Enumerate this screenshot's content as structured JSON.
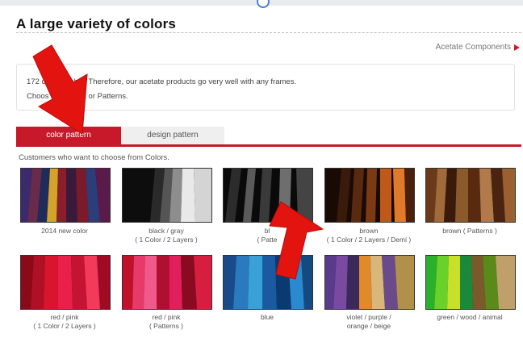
{
  "page": {
    "title": "A large variety of colors",
    "acetate_link": "Acetate Components",
    "info_line1": "172 c          e available. Therefore, our acetate products go very well with any frames.",
    "info_line2": "Choos            her Colors or Patterns.",
    "subtitle": "Customers who want to choose from Colors."
  },
  "tabs": [
    {
      "label": "color pattern",
      "active": true
    },
    {
      "label": "design pattern",
      "active": false
    }
  ],
  "swatches": [
    {
      "cap1": "2014 new color",
      "cap2": ""
    },
    {
      "cap1": "black / gray",
      "cap2": "( 1 Color / 2 Layers )"
    },
    {
      "cap1": "bl",
      "cap2": "( Patte"
    },
    {
      "cap1": "brown",
      "cap2": "( 1 Color / 2 Layers / Demi )"
    },
    {
      "cap1": "brown ( Patterns )",
      "cap2": ""
    },
    {
      "cap1": "red / pink",
      "cap2": "( 1 Color / 2 Layers )"
    },
    {
      "cap1": "red / pink",
      "cap2": "( Patterns )"
    },
    {
      "cap1": "blue",
      "cap2": ""
    },
    {
      "cap1": "violet / purple /",
      "cap2": "orange / beige"
    },
    {
      "cap1": "green / wood / animal",
      "cap2": ""
    }
  ],
  "colors": {
    "accent": "#c8192a",
    "arrow": "#e3140f"
  },
  "icons": [
    "arrow-right-icon",
    "red-arrow-icon"
  ]
}
